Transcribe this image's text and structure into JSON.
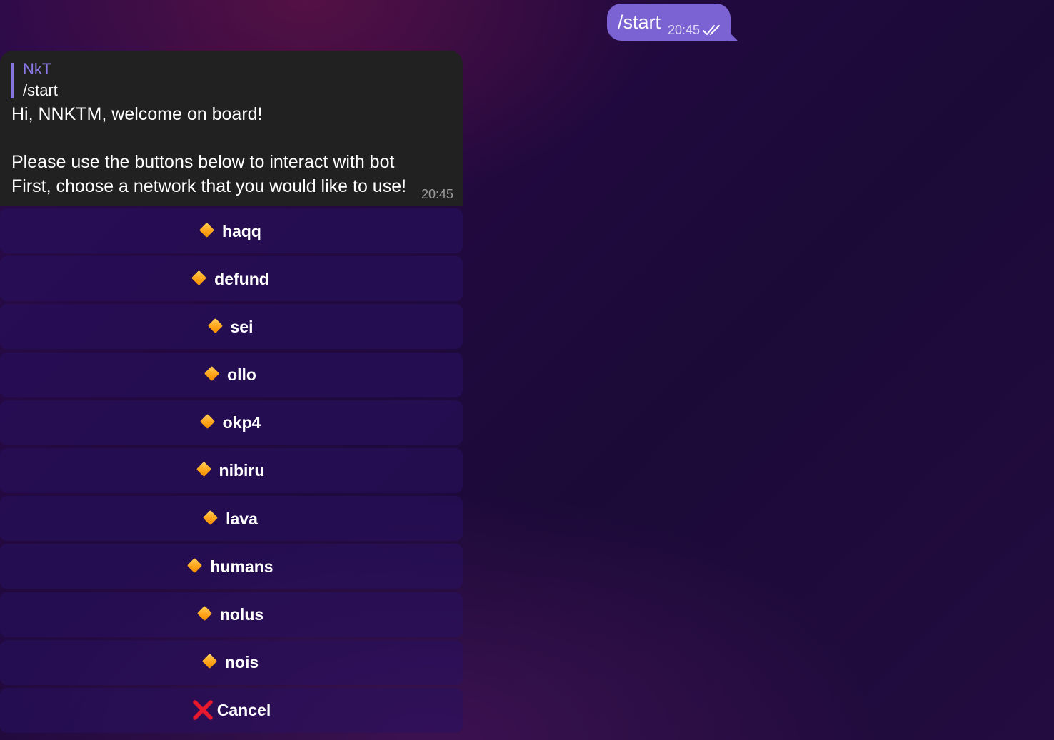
{
  "outgoing": {
    "text": "/start",
    "time": "20:45",
    "status_icon": "double-check-icon"
  },
  "incoming": {
    "reply": {
      "name": "NkT",
      "text": "/start"
    },
    "lines": [
      "Hi, NNKTM, welcome on board!",
      "Please use the buttons below to interact with bot",
      "First, choose a network that you would like to use!"
    ],
    "time": "20:45"
  },
  "keyboard": {
    "buttons": [
      {
        "label": "haqq",
        "icon": "orange-diamond-icon"
      },
      {
        "label": "defund",
        "icon": "orange-diamond-icon"
      },
      {
        "label": "sei",
        "icon": "orange-diamond-icon"
      },
      {
        "label": "ollo",
        "icon": "orange-diamond-icon"
      },
      {
        "label": "okp4",
        "icon": "orange-diamond-icon"
      },
      {
        "label": "nibiru",
        "icon": "orange-diamond-icon"
      },
      {
        "label": "lava",
        "icon": "orange-diamond-icon"
      },
      {
        "label": "humans",
        "icon": "orange-diamond-icon"
      },
      {
        "label": "nolus",
        "icon": "orange-diamond-icon"
      },
      {
        "label": "nois",
        "icon": "orange-diamond-icon"
      },
      {
        "label": "Cancel",
        "icon": "red-cross-icon"
      }
    ]
  },
  "colors": {
    "outgoing_bubble": "#7b63d4",
    "incoming_bubble": "#212121",
    "reply_accent": "#8774e1",
    "diamond": "#ffa51c",
    "cancel_cross": "#e8192c"
  }
}
